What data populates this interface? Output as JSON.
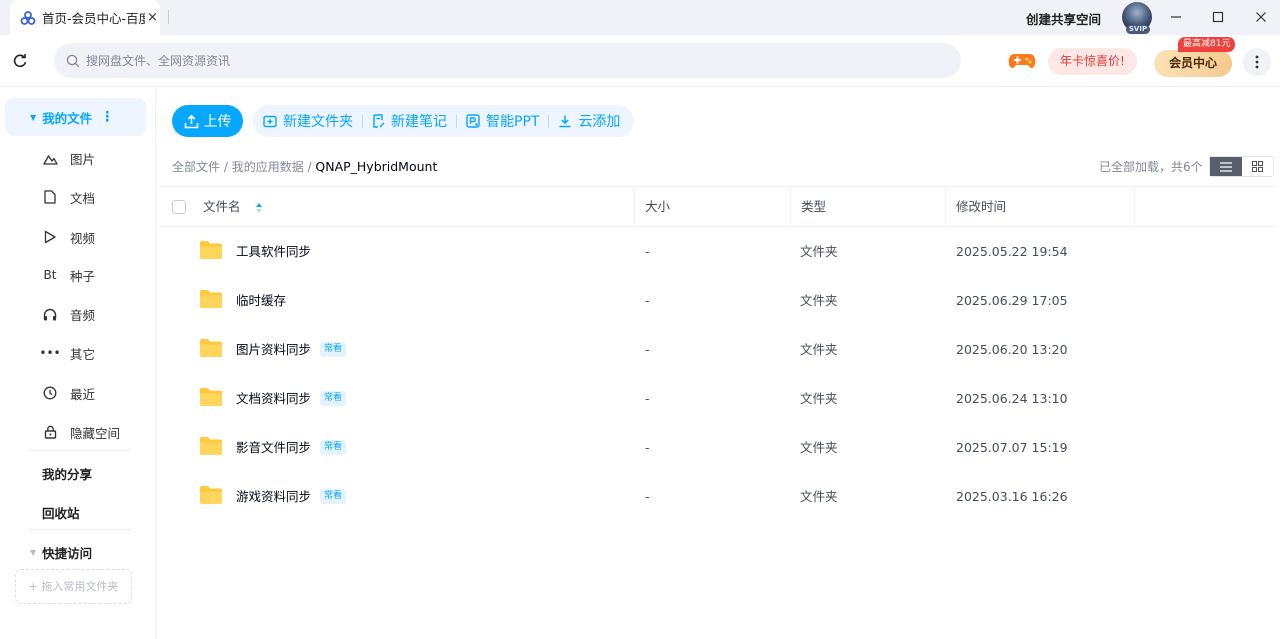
{
  "window": {
    "tab_title": "首页-会员中心-百度网盘",
    "tab_close": "×",
    "create_space": "创建共享空间",
    "avatar_badge": "SVIP",
    "minimize": "minimize-icon",
    "maximize": "maximize-icon",
    "close": "close-icon"
  },
  "toolbar": {
    "search_placeholder": "搜网盘文件、全网资源资讯",
    "promo": "年卡惊喜价!",
    "vip_center": "会员中心",
    "vip_badge": "最高减81元"
  },
  "sidebar": {
    "my_files": "我的文件",
    "items": [
      {
        "label": "图片",
        "icon": "image-icon"
      },
      {
        "label": "文档",
        "icon": "document-icon"
      },
      {
        "label": "视频",
        "icon": "video-icon"
      },
      {
        "label": "种子",
        "icon": "torrent-icon",
        "glyph": "Bt"
      },
      {
        "label": "音频",
        "icon": "headphones-icon"
      },
      {
        "label": "其它",
        "icon": "more-dots-icon",
        "glyph": "•••"
      },
      {
        "label": "最近",
        "icon": "clock-icon"
      },
      {
        "label": "隐藏空间",
        "icon": "lock-icon"
      }
    ],
    "my_share": "我的分享",
    "recycle_bin": "回收站",
    "quick_access": "快捷访问",
    "drag_hint": "+ 拖入常用文件夹"
  },
  "actions": {
    "upload": "上传",
    "new_folder": "新建文件夹",
    "new_note": "新建笔记",
    "smart_ppt": "智能PPT",
    "cloud_add": "云添加"
  },
  "breadcrumb": {
    "root": "全部文件",
    "sep": " / ",
    "app_data": "我的应用数据",
    "current": "QNAP_HybridMount"
  },
  "status": {
    "loaded": "已全部加载，共6个"
  },
  "table": {
    "columns": [
      "文件名",
      "大小",
      "类型",
      "修改时间"
    ],
    "rows": [
      {
        "name": "工具软件同步",
        "tag": "",
        "size": "-",
        "type": "文件夹",
        "modified": "2025.05.22 19:54"
      },
      {
        "name": "临时缓存",
        "tag": "",
        "size": "-",
        "type": "文件夹",
        "modified": "2025.06.29 17:05"
      },
      {
        "name": "图片资料同步",
        "tag": "常看",
        "size": "-",
        "type": "文件夹",
        "modified": "2025.06.20 13:20"
      },
      {
        "name": "文档资料同步",
        "tag": "常看",
        "size": "-",
        "type": "文件夹",
        "modified": "2025.06.24 13:10"
      },
      {
        "name": "影音文件同步",
        "tag": "常看",
        "size": "-",
        "type": "文件夹",
        "modified": "2025.07.07 15:19"
      },
      {
        "name": "游戏资料同步",
        "tag": "常看",
        "size": "-",
        "type": "文件夹",
        "modified": "2025.03.16 16:26"
      }
    ]
  },
  "colors": {
    "accent": "#06a7ff",
    "accent_light": "#eef5ff",
    "folder": "#ffc83d",
    "promo_red": "#e6362f"
  }
}
